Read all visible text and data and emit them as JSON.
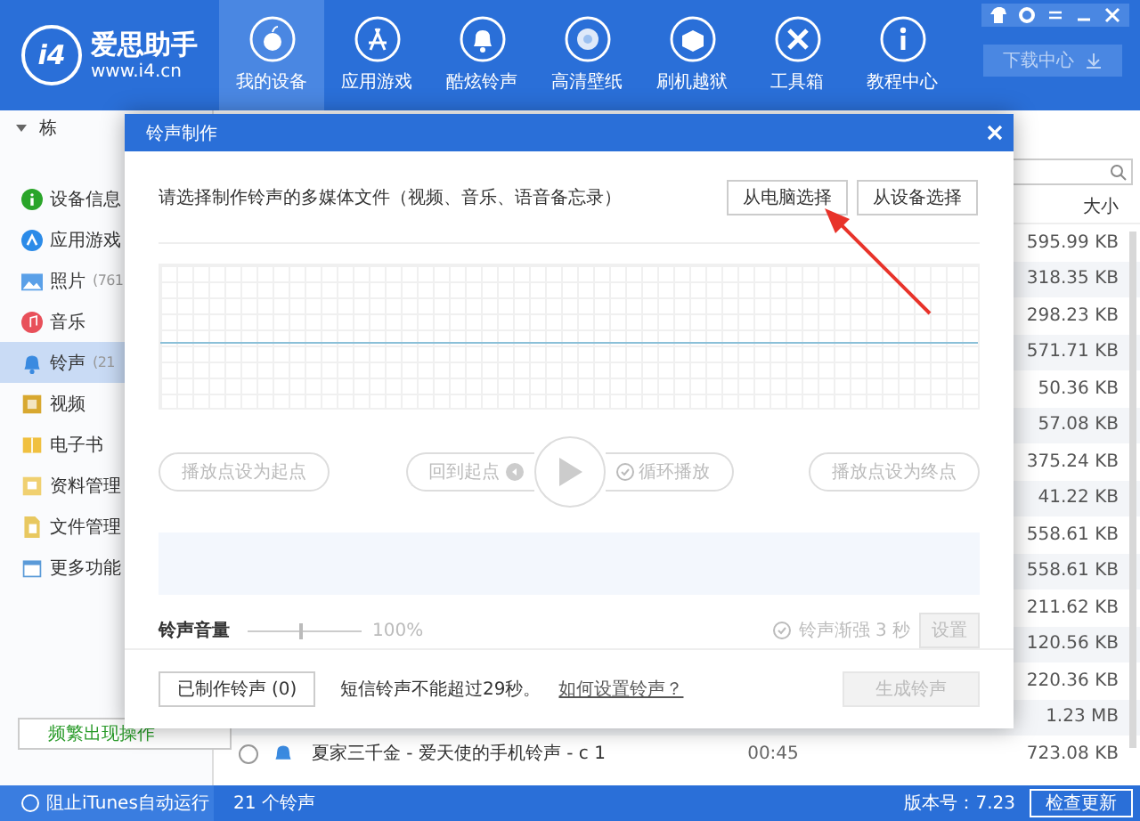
{
  "header": {
    "logo_mark": "i4",
    "app_name": "爱思助手",
    "url": "www.i4.cn",
    "download_button": "下载中心",
    "tabs": [
      {
        "label": "我的设备",
        "selected": true
      },
      {
        "label": "应用游戏",
        "selected": false
      },
      {
        "label": "酷炫铃声",
        "selected": false
      },
      {
        "label": "高清壁纸",
        "selected": false
      },
      {
        "label": "刷机越狱",
        "selected": false
      },
      {
        "label": "工具箱",
        "selected": false
      },
      {
        "label": "教程中心",
        "selected": false
      }
    ]
  },
  "sidebar": {
    "device": "栋",
    "action_button": "频繁出现操作",
    "items": [
      {
        "label": "设备信息",
        "selected": false
      },
      {
        "label": "应用游戏",
        "selected": false
      },
      {
        "label": "照片",
        "count": "(761",
        "selected": false
      },
      {
        "label": "音乐",
        "selected": false
      },
      {
        "label": "铃声",
        "count": "(21",
        "selected": true
      },
      {
        "label": "视频",
        "selected": false
      },
      {
        "label": "电子书",
        "selected": false
      },
      {
        "label": "资料管理",
        "selected": false
      },
      {
        "label": "文件管理",
        "selected": false
      },
      {
        "label": "更多功能",
        "selected": false
      }
    ]
  },
  "content": {
    "columns": [
      "大小"
    ],
    "rows": [
      {
        "size": "595.99 KB"
      },
      {
        "size": "318.35 KB"
      },
      {
        "size": "298.23 KB"
      },
      {
        "size": "571.71 KB"
      },
      {
        "size": "50.36 KB"
      },
      {
        "size": "57.08 KB"
      },
      {
        "size": "375.24 KB"
      },
      {
        "size": "41.22 KB"
      },
      {
        "size": "558.61 KB"
      },
      {
        "size": "558.61 KB"
      },
      {
        "size": "211.62 KB"
      },
      {
        "size": "120.56 KB"
      },
      {
        "size": "220.36 KB"
      },
      {
        "size": "1.23 MB"
      },
      {
        "name": "夏家三千金 - 爱天使的手机铃声 - c 1",
        "duration": "00:45",
        "size": "723.08 KB",
        "selected": false
      }
    ]
  },
  "dialog": {
    "title": "铃声制作",
    "prompt": "请选择制作铃声的多媒体文件（视频、音乐、语音备忘录）",
    "source_buttons": [
      "从电脑选择",
      "从设备选择"
    ],
    "start_button": {
      "label": "播放点设为起点",
      "disabled": true
    },
    "back_button": {
      "label": "回到起点",
      "disabled": true
    },
    "loop_button": {
      "label": "循环播放",
      "disabled": true
    },
    "end_button": {
      "label": "播放点设为终点",
      "disabled": true
    },
    "volume": {
      "label": "铃声音量",
      "level": 0.47,
      "reading": "100%"
    },
    "fade_label": "铃声渐强 3 秒",
    "settings_button": {
      "label": "设置",
      "disabled": true
    },
    "made_button": "已制作铃声 (0)",
    "note": "短信铃声不能超过29秒。",
    "help_link": "如何设置铃声？",
    "generate_button": {
      "label": "生成铃声",
      "disabled": true
    }
  },
  "status_bar": {
    "itunes": "阻止iTunes自动运行",
    "itunes_checked": false,
    "count": "21 个铃声",
    "version": "版本号：7.23",
    "update_button": "检查更新"
  }
}
